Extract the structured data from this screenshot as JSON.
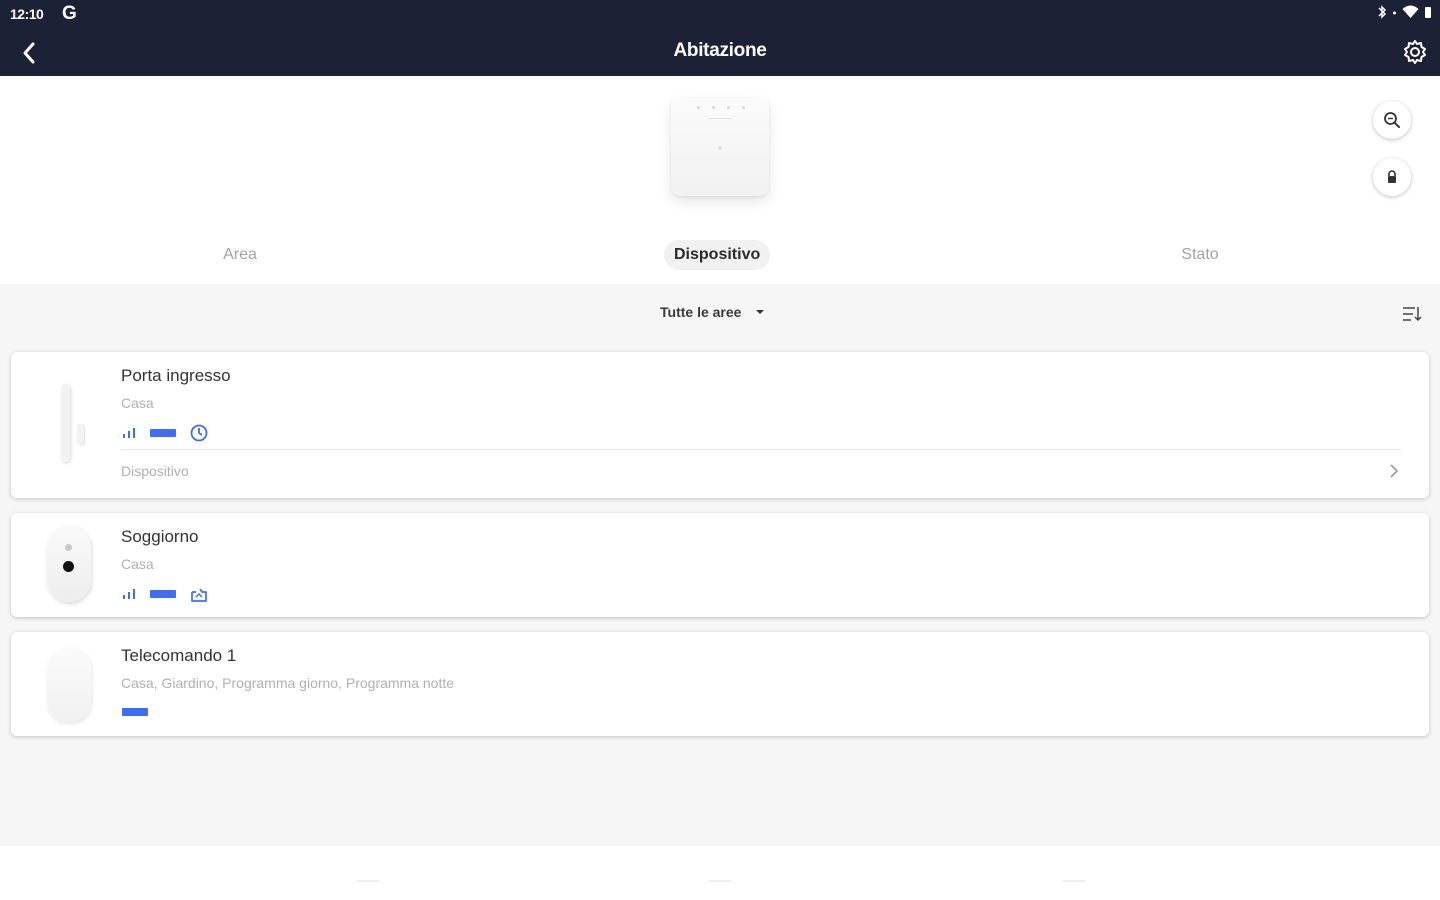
{
  "status_bar": {
    "time": "12:10",
    "g_label": "G"
  },
  "header": {
    "title": "Abitazione"
  },
  "tabs": [
    {
      "label": "Area",
      "active": false
    },
    {
      "label": "Dispositivo",
      "active": true
    },
    {
      "label": "Stato",
      "active": false
    }
  ],
  "filter": {
    "label": "Tutte le aree"
  },
  "devices": [
    {
      "name": "Porta ingresso",
      "areas": "Casa",
      "footer": "Dispositivo"
    },
    {
      "name": "Soggiorno",
      "areas": "Casa"
    },
    {
      "name": "Telecomando 1",
      "areas": "Casa, Giardino, Programma giorno, Programma notte"
    }
  ],
  "colors": {
    "header_bg": "#1c2135",
    "accent": "#3f6ef5",
    "list_bg": "#f6f6f6"
  }
}
